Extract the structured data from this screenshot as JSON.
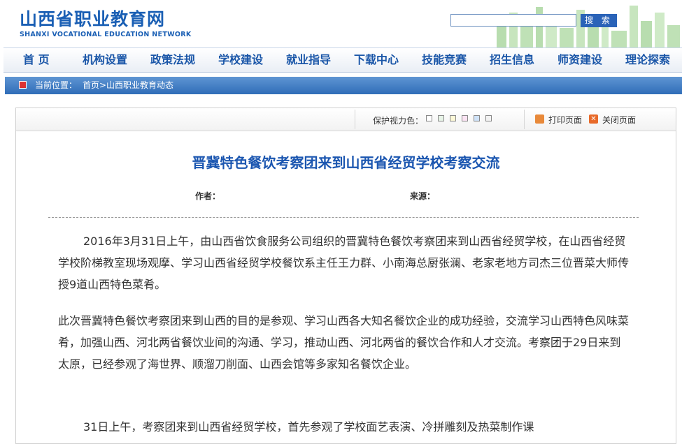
{
  "site": {
    "name_cn": "山西省职业教育网",
    "name_en": "SHANXI VOCATIONAL EDUCATION NETWORK",
    "search_button": "搜 索",
    "search_value": "",
    "brand_color": "#1a5fb4"
  },
  "nav": [
    "首 页",
    "机构设置",
    "政策法规",
    "学校建设",
    "就业指导",
    "下载中心",
    "技能竞赛",
    "招生信息",
    "师资建设",
    "理论探索"
  ],
  "breadcrumb": {
    "label": "当前位置：",
    "path": "首页>山西职业教育动态"
  },
  "toolbar": {
    "eye_label": "保护视力色：",
    "swatches": [
      "#ffffff",
      "#e8f4e8",
      "#fdf9d8",
      "#fbe3f3",
      "#cfe2f7",
      "#f2f2f2"
    ],
    "print": "打印页面",
    "close": "关闭页面"
  },
  "article": {
    "title": "晋冀特色餐饮考察团来到山西省经贸学校考察交流",
    "author_label": "作者：",
    "source_label": "来源：",
    "paragraphs": [
      "2016年3月31日上午，由山西省饮食服务公司组织的晋冀特色餐饮考察团来到山西省经贸学校，在山西省经贸学校阶梯教室现场观摩、学习山西省经贸学校餐饮系主任王力群、小南海总厨张澜、老家老地方司杰三位晋菜大师传授9道山西特色菜肴。",
      "此次晋冀特色餐饮考察团来到山西的目的是参观、学习山西各大知名餐饮企业的成功经验，交流学习山西特色风味菜肴，加强山西、河北两省餐饮业间的沟通、学习，推动山西、河北两省的餐饮合作和人才交流。考察团于29日来到太原，已经参观了海世界、顺溜刀削面、山西会馆等多家知名餐饮企业。",
      "31日上午，考察团来到山西省经贸学校，首先参观了学校面艺表演、冷拼雕刻及热菜制作课"
    ]
  }
}
